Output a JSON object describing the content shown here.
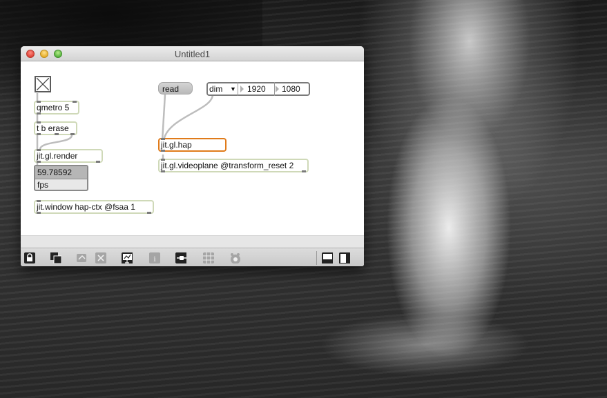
{
  "window": {
    "title": "Untitled1"
  },
  "patch": {
    "toggle_label": "",
    "qmetro": "qmetro 5",
    "trigger": "t b erase",
    "render": "jit.gl.render",
    "fps_value": "59.78592",
    "fps_label": "fps",
    "jit_window": "jit.window hap-ctx @fsaa 1",
    "read_msg": "read",
    "dim_menu": "dim",
    "dim_w": "1920",
    "dim_h": "1080",
    "hap": "jit.gl.hap",
    "videoplane": "jit.gl.videoplane @transform_reset 2"
  },
  "toolbar": {
    "icons": [
      "lock-icon",
      "presentation-icon",
      "clipboard-icon",
      "delete-icon",
      "debug-icon",
      "info-icon",
      "connect-icon",
      "grid-icon",
      "extras-icon",
      "sidebar-bottom-icon",
      "sidebar-right-icon"
    ]
  },
  "colors": {
    "object_border": "#cfd9b8",
    "selected_border": "#e07b1a",
    "cord": "#bdbdbd"
  }
}
